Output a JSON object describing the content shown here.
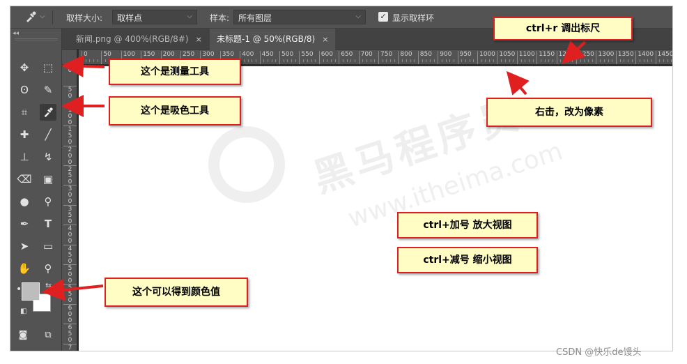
{
  "options_bar": {
    "tool_icon": "eyedropper-icon",
    "sample_size_label": "取样大小:",
    "sample_size_value": "取样点",
    "sample_label": "样本:",
    "sample_value": "所有图层",
    "show_ring_label": "显示取样环",
    "show_ring_checked": true
  },
  "tabs": [
    {
      "label": "新闻.png @ 400%(RGB/8#)",
      "active": false
    },
    {
      "label": "未标题-1 @ 50%(RGB/8)",
      "active": true
    }
  ],
  "tab_close_glyph": "×",
  "ruler": {
    "h_labels": [
      "0",
      "50",
      "100",
      "150",
      "200",
      "250",
      "300",
      "350",
      "400",
      "450",
      "500",
      "550",
      "600",
      "650",
      "700",
      "750",
      "800",
      "850",
      "900",
      "950",
      "1000",
      "1050",
      "1100",
      "1150",
      "1200",
      "1250",
      "1300",
      "1350",
      "1400",
      "1450"
    ],
    "v_labels": [
      "0",
      "5\n0",
      "1\n0\n0",
      "1\n5\n0",
      "2\n0\n0",
      "2\n5\n0",
      "3\n0\n0",
      "3\n5\n0",
      "4\n0\n0",
      "4\n5\n0",
      "5\n0\n0",
      "5\n5\n0",
      "6\n0\n0",
      "6\n5\n0",
      "7"
    ]
  },
  "tools": {
    "rows": [
      [
        "move-icon",
        "marquee-icon"
      ],
      [
        "lasso-icon",
        "quick-select-icon"
      ],
      [
        "crop-icon",
        "eyedropper-icon"
      ],
      [
        "healing-icon",
        "brush-icon"
      ],
      [
        "stamp-icon",
        "history-brush-icon"
      ],
      [
        "eraser-icon",
        "gradient-icon"
      ],
      [
        "blur-icon",
        "dodge-icon"
      ],
      [
        "pen-icon",
        "type-icon"
      ],
      [
        "path-select-icon",
        "rectangle-icon"
      ],
      [
        "hand-icon",
        "zoom-icon"
      ],
      [
        "more-icon"
      ]
    ],
    "fg_color": "#bdbdbd",
    "bg_color": "#ffffff"
  },
  "watermark": {
    "cn": "黑马程序员",
    "en": "www.itheima.com"
  },
  "callouts": {
    "ruler": "ctrl+r 调出标尺",
    "measure": "这个是测量工具",
    "eyedropper": "这个是吸色工具",
    "right_click": "右击，改为像素",
    "zoom_in": "ctrl+加号 放大视图",
    "zoom_out": "ctrl+减号 缩小视图",
    "color_value": "这个可以得到颜色值"
  },
  "credit": "CSDN @快乐de馒头",
  "colors": {
    "accent_red": "#e02020",
    "callout_bg": "#fffcc4",
    "panel": "#535353"
  }
}
